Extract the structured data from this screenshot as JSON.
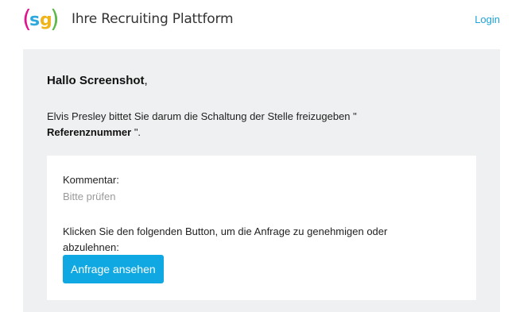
{
  "header": {
    "logo_text": "sg",
    "brand": "Ihre Recruiting Plattform",
    "login": "Login",
    "colors": {
      "logo_paren_left": "#e0148b",
      "logo_s": "#2ea9dc",
      "logo_g": "#f0b41b",
      "logo_paren_right": "#5cb848",
      "link": "#1fa3d8"
    }
  },
  "main": {
    "greeting_name": "Hallo Screenshot",
    "greeting_punct": ",",
    "message_pre": "Elvis Presley bittet Sie darum die Schaltung der Stelle freizugeben \"",
    "message_ref": "Referenznummer",
    "message_post": " \".",
    "card": {
      "comment_label": "Kommentar:",
      "comment_value": "Bitte prüfen",
      "instruction": "Klicken Sie den folgenden Button, um die Anfrage zu genehmigen oder abzulehnen:",
      "button_label": "Anfrage ansehen",
      "button_color": "#0fa8e3"
    }
  }
}
